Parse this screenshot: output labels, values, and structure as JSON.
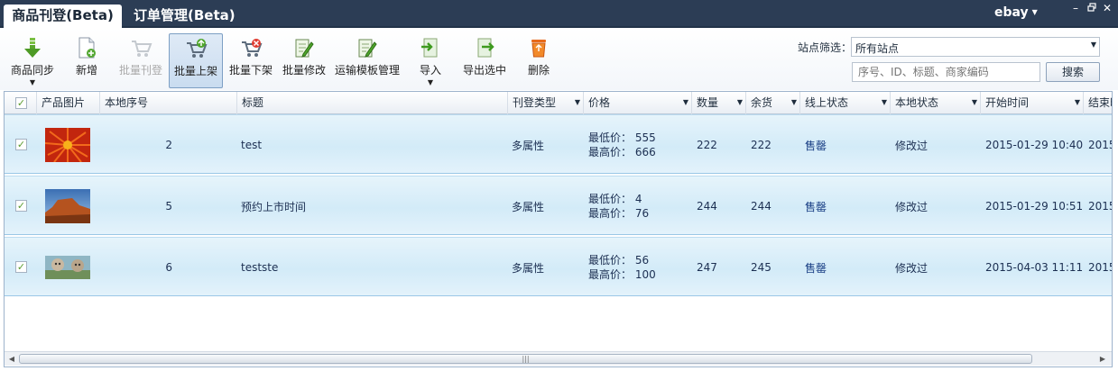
{
  "tabs": [
    {
      "label": "商品刊登(Beta)",
      "active": true
    },
    {
      "label": "订单管理(Beta)",
      "active": false
    }
  ],
  "account": {
    "name": "ebay"
  },
  "window_controls": {
    "minimize": "–",
    "restore": "▫",
    "close": "✕"
  },
  "toolbar": {
    "buttons": [
      {
        "label": "商品同步",
        "icon": "download-arrow-icon",
        "has_dropdown": true,
        "enabled": true
      },
      {
        "label": "新增",
        "icon": "new-document-icon",
        "enabled": true
      },
      {
        "label": "批量刊登",
        "icon": "publish-cart-icon",
        "enabled": false
      },
      {
        "label": "批量上架",
        "icon": "cart-up-icon",
        "enabled": true,
        "pressed": true
      },
      {
        "label": "批量下架",
        "icon": "cart-remove-icon",
        "enabled": true
      },
      {
        "label": "批量修改",
        "icon": "edit-document-icon",
        "enabled": true
      },
      {
        "label": "运输模板管理",
        "icon": "edit-template-icon",
        "enabled": true
      },
      {
        "label": "导入",
        "icon": "import-icon",
        "has_dropdown": true,
        "enabled": true
      },
      {
        "label": "导出选中",
        "icon": "export-icon",
        "enabled": true
      },
      {
        "label": "删除",
        "icon": "recycle-bin-icon",
        "enabled": true
      }
    ]
  },
  "filter": {
    "label": "站点筛选：",
    "selected": "所有站点",
    "search_placeholder": "序号、ID、标题、商家编码",
    "search_button": "搜索"
  },
  "grid": {
    "columns": [
      "产品图片",
      "本地序号",
      "标题",
      "刊登类型",
      "价格",
      "数量",
      "余货",
      "线上状态",
      "本地状态",
      "开始时间",
      "结束时"
    ],
    "rows": [
      {
        "checked": true,
        "local_no": "2",
        "title": "test",
        "listing_type": "多属性",
        "min_price": "最低价： 555",
        "max_price": "最高价： 666",
        "quantity": "222",
        "remaining": "222",
        "online_status": "售罄",
        "local_status": "修改过",
        "start_time": "2015-01-29 10:40",
        "end_time": "2015",
        "image": "red-flower"
      },
      {
        "checked": true,
        "local_no": "5",
        "title": "预约上市时间",
        "listing_type": "多属性",
        "min_price": "最低价： 4",
        "max_price": "最高价： 76",
        "quantity": "244",
        "remaining": "244",
        "online_status": "售罄",
        "local_status": "修改过",
        "start_time": "2015-01-29 10:51",
        "end_time": "2015",
        "image": "desert-rock"
      },
      {
        "checked": true,
        "local_no": "6",
        "title": "teststе",
        "listing_type": "多属性",
        "min_price": "最低价： 56",
        "max_price": "最高价： 100",
        "quantity": "247",
        "remaining": "245",
        "online_status": "售罄",
        "local_status": "修改过",
        "start_time": "2015-04-03 11:11",
        "end_time": "2015",
        "image": "koalas"
      }
    ]
  },
  "colors": {
    "topbar": "#2c3d55",
    "row_bg": "#d3ebf8",
    "accent": "#1a3f85"
  }
}
